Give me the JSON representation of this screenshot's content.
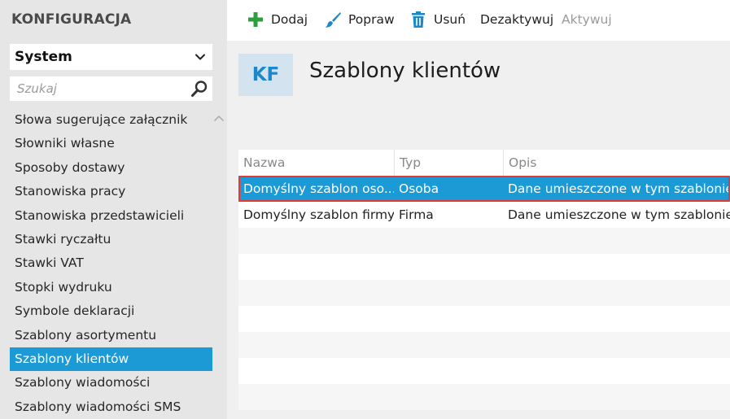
{
  "sidebar": {
    "app_title": "KONFIGURACJA",
    "selector_value": "System",
    "search_placeholder": "Szukaj",
    "items": [
      {
        "label": "Słowa sugerujące załącznik"
      },
      {
        "label": "Słowniki własne"
      },
      {
        "label": "Sposoby dostawy"
      },
      {
        "label": "Stanowiska pracy"
      },
      {
        "label": "Stanowiska przedstawicieli"
      },
      {
        "label": "Stawki ryczałtu"
      },
      {
        "label": "Stawki VAT"
      },
      {
        "label": "Stopki wydruku"
      },
      {
        "label": "Symbole deklaracji"
      },
      {
        "label": "Szablony asortymentu"
      },
      {
        "label": "Szablony klientów",
        "active": true
      },
      {
        "label": "Szablony wiadomości"
      },
      {
        "label": "Szablony wiadomości SMS"
      }
    ]
  },
  "toolbar": {
    "add_label": "Dodaj",
    "edit_label": "Popraw",
    "delete_label": "Usuń",
    "deactivate_label": "Dezaktywuj",
    "activate_label": "Aktywuj"
  },
  "page": {
    "badge": "KF",
    "title": "Szablony klientów"
  },
  "grid": {
    "columns": [
      "Nazwa",
      "Typ",
      "Opis"
    ],
    "rows": [
      {
        "name": "Domyślny szablon oso...",
        "type": "Osoba",
        "desc": "Dane umieszczone w tym szablonie b",
        "selected": true
      },
      {
        "name": "Domyślny szablon firmy",
        "type": "Firma",
        "desc": "Dane umieszczone w tym szablonie b",
        "selected": false
      }
    ],
    "empty_rows": 7
  },
  "colors": {
    "accent": "#1c9ad6",
    "add_icon": "#2e9e3e",
    "selection_outline": "#e53935",
    "sidebar_bg": "#e6e6e6",
    "content_bg": "#f0f0f0"
  },
  "icons": {
    "add": "plus-icon",
    "edit": "brush-icon",
    "delete": "trash-icon",
    "search": "magnifier-icon",
    "select": "chevron-down-icon",
    "scroll": "chevron-up-icon"
  }
}
